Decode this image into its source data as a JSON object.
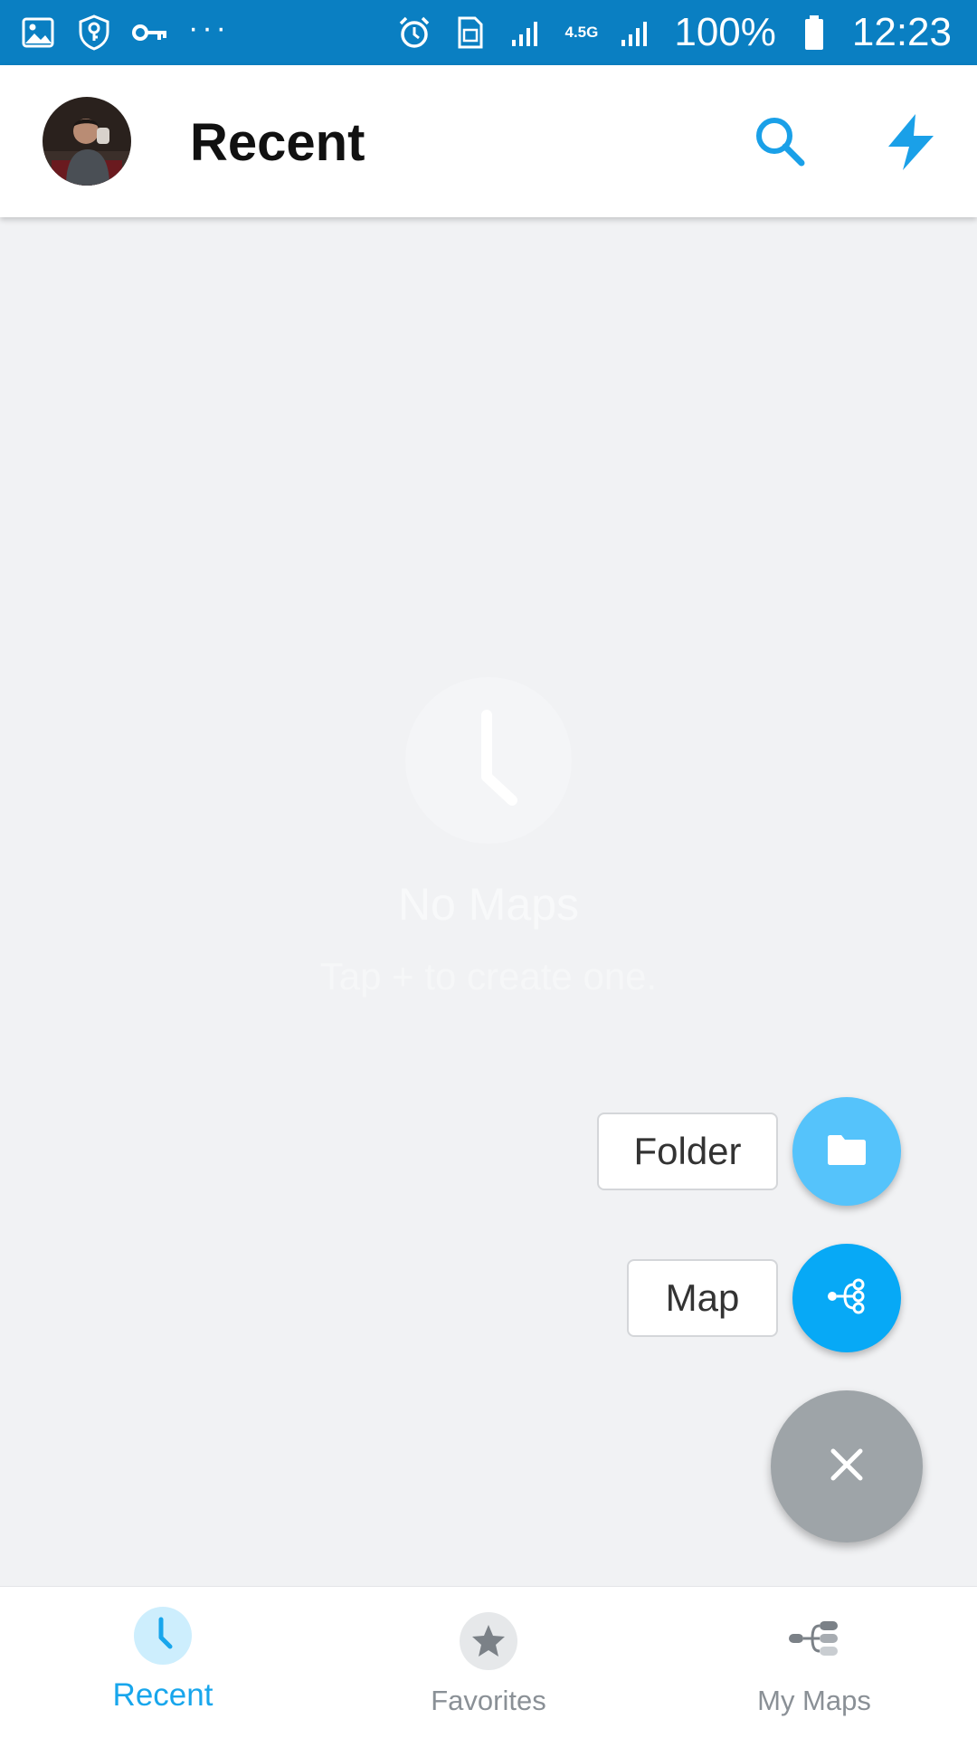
{
  "status_bar": {
    "left_icons": [
      "gallery-icon",
      "shield-key-icon",
      "key-icon",
      "more-dots-icon"
    ],
    "right_icons": [
      "alarm-icon",
      "sim-card-icon",
      "signal-icon",
      "signal-icon",
      "battery-icon"
    ],
    "network": "4.5G",
    "battery": "100%",
    "time": "12:23"
  },
  "app_bar": {
    "title": "Recent",
    "actions": [
      "search-icon",
      "bolt-icon"
    ]
  },
  "empty_state": {
    "icon": "clock-icon",
    "title": "No Maps",
    "subtitle": "Tap + to create one."
  },
  "speed_dial": {
    "options": [
      {
        "label": "Folder",
        "icon": "folder-icon",
        "color": "#55c3fb"
      },
      {
        "label": "Map",
        "icon": "mind-map-icon",
        "color": "#07a9f6"
      }
    ],
    "close_icon": "close-icon",
    "close_color": "#9ea4a8"
  },
  "bottom_nav": {
    "items": [
      {
        "label": "Recent",
        "icon": "clock-icon",
        "active": true
      },
      {
        "label": "Favorites",
        "icon": "star-icon",
        "active": false
      },
      {
        "label": "My Maps",
        "icon": "mind-map-icon",
        "active": false
      }
    ]
  },
  "colors": {
    "status_bar": "#0a7fc2",
    "accent": "#18a6ec",
    "background": "#f1f2f4"
  }
}
